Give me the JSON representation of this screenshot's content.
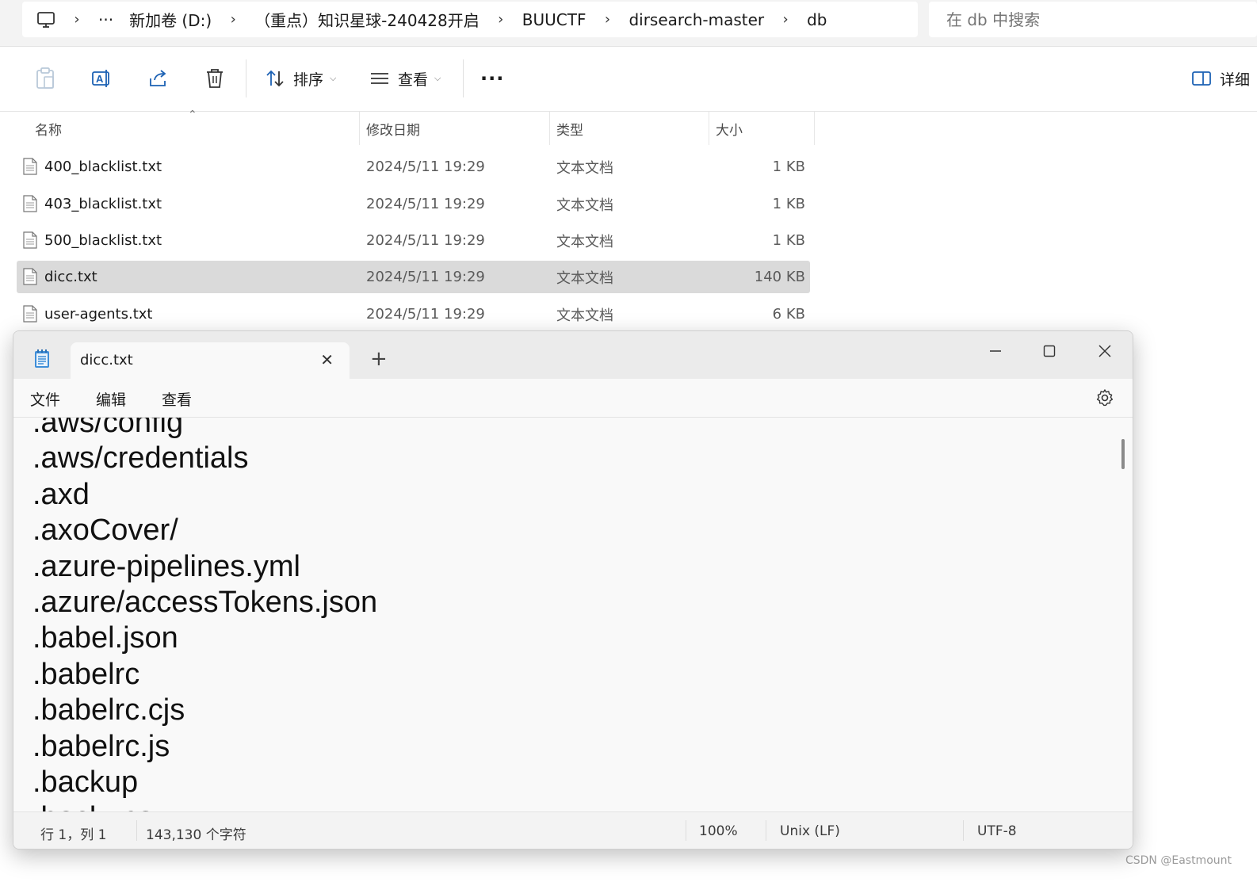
{
  "explorer": {
    "breadcrumbs": [
      "新加卷 (D:)",
      "（重点）知识星球-240428开启",
      "BUUCTF",
      "dirsearch-master",
      "db"
    ],
    "overflow_label": "···",
    "search_placeholder": "在 db 中搜索",
    "toolbar": {
      "sort_label": "排序",
      "view_label": "查看",
      "more_label": "···",
      "details_label": "详细"
    },
    "columns": {
      "name": "名称",
      "date": "修改日期",
      "type": "类型",
      "size": "大小"
    },
    "files": [
      {
        "name": "400_blacklist.txt",
        "date": "2024/5/11 19:29",
        "type": "文本文档",
        "size": "1 KB"
      },
      {
        "name": "403_blacklist.txt",
        "date": "2024/5/11 19:29",
        "type": "文本文档",
        "size": "1 KB"
      },
      {
        "name": "500_blacklist.txt",
        "date": "2024/5/11 19:29",
        "type": "文本文档",
        "size": "1 KB"
      },
      {
        "name": "dicc.txt",
        "date": "2024/5/11 19:29",
        "type": "文本文档",
        "size": "140 KB"
      },
      {
        "name": "user-agents.txt",
        "date": "2024/5/11 19:29",
        "type": "文本文档",
        "size": "6 KB"
      }
    ]
  },
  "notepad": {
    "tab_title": "dicc.txt",
    "new_tab": "+",
    "menu": {
      "file": "文件",
      "edit": "编辑",
      "view": "查看"
    },
    "lines": [
      ".aws/config",
      ".aws/credentials",
      ".axd",
      ".axoCover/",
      ".azure-pipelines.yml",
      ".azure/accessTokens.json",
      ".babel.json",
      ".babelrc",
      ".babelrc.cjs",
      ".babelrc.js",
      ".backup",
      ".backups"
    ],
    "status": {
      "position": "行 1，列 1",
      "chars": "143,130 个字符",
      "zoom": "100%",
      "line_ending": "Unix (LF)",
      "encoding": "UTF-8"
    }
  },
  "watermark": "CSDN @Eastmount"
}
